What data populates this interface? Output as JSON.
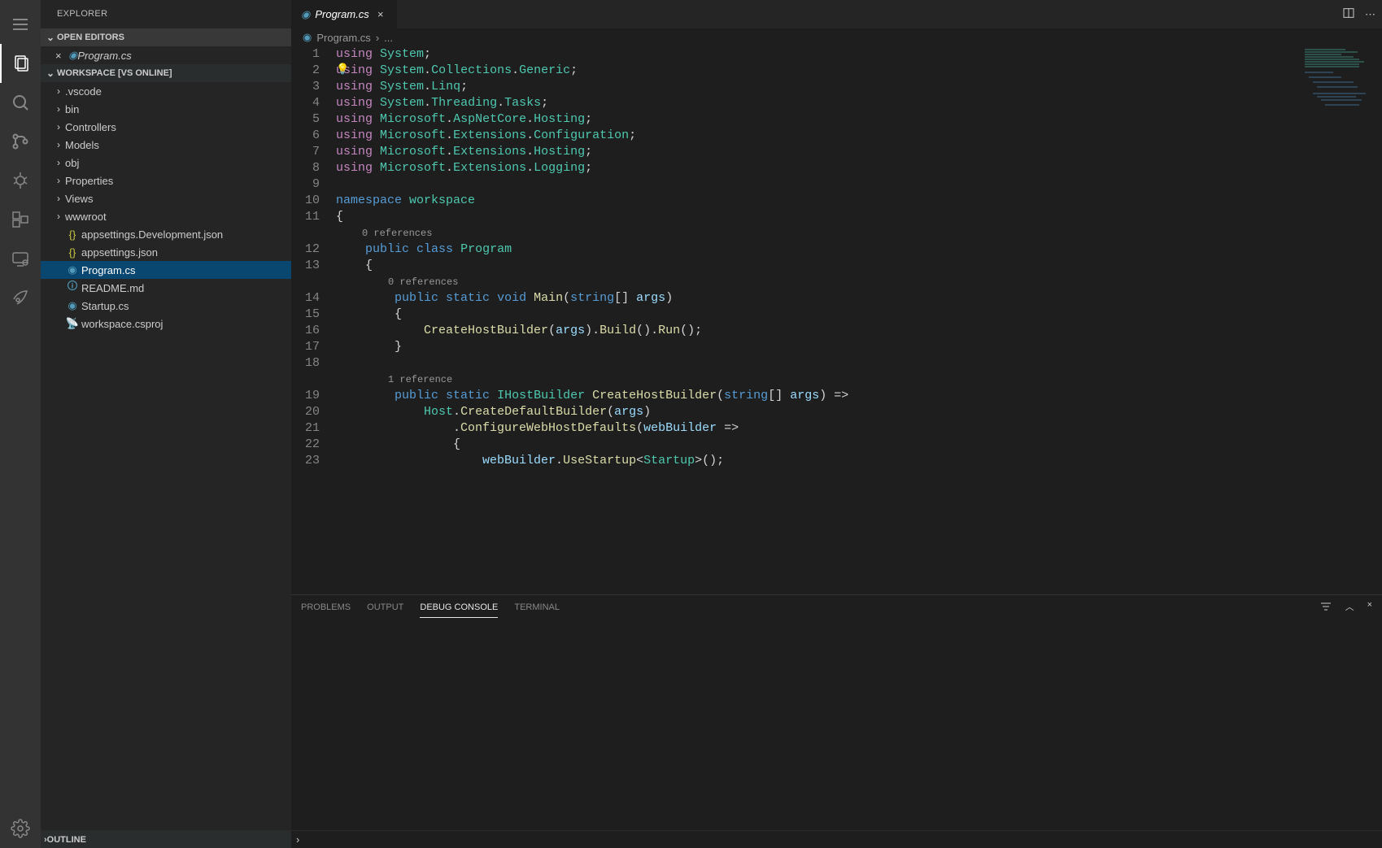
{
  "sidebar": {
    "title": "EXPLORER",
    "openEditorsHeader": "OPEN EDITORS",
    "openEditorItem": "Program.cs",
    "workspaceHeader": "WORKSPACE [VS ONLINE]",
    "outlineHeader": "OUTLINE",
    "folders": [
      ".vscode",
      "bin",
      "Controllers",
      "Models",
      "obj",
      "Properties",
      "Views",
      "wwwroot"
    ],
    "files": [
      {
        "name": "appsettings.Development.json",
        "icon": "json"
      },
      {
        "name": "appsettings.json",
        "icon": "json"
      },
      {
        "name": "Program.cs",
        "icon": "cs",
        "selected": true
      },
      {
        "name": "README.md",
        "icon": "md"
      },
      {
        "name": "Startup.cs",
        "icon": "cs"
      },
      {
        "name": "workspace.csproj",
        "icon": "xml"
      }
    ]
  },
  "tabs": {
    "active": "Program.cs"
  },
  "breadcrumbs": {
    "file": "Program.cs",
    "sep": "›",
    "rest": "..."
  },
  "codelens": {
    "zero": "0 references",
    "one": "1 reference"
  },
  "code": {
    "l1": [
      [
        "kw-using",
        "using"
      ],
      [
        "pl",
        " "
      ],
      [
        "ns",
        "System"
      ],
      [
        "pl",
        ";"
      ]
    ],
    "l2": [
      [
        "kw-using",
        "using"
      ],
      [
        "pl",
        " "
      ],
      [
        "ns",
        "System"
      ],
      [
        "pl",
        "."
      ],
      [
        "ns",
        "Collections"
      ],
      [
        "pl",
        "."
      ],
      [
        "ns",
        "Generic"
      ],
      [
        "pl",
        ";"
      ]
    ],
    "l3": [
      [
        "kw-using",
        "using"
      ],
      [
        "pl",
        " "
      ],
      [
        "ns",
        "System"
      ],
      [
        "pl",
        "."
      ],
      [
        "ns",
        "Linq"
      ],
      [
        "pl",
        ";"
      ]
    ],
    "l4": [
      [
        "kw-using",
        "using"
      ],
      [
        "pl",
        " "
      ],
      [
        "ns",
        "System"
      ],
      [
        "pl",
        "."
      ],
      [
        "ns",
        "Threading"
      ],
      [
        "pl",
        "."
      ],
      [
        "ns",
        "Tasks"
      ],
      [
        "pl",
        ";"
      ]
    ],
    "l5": [
      [
        "kw-using",
        "using"
      ],
      [
        "pl",
        " "
      ],
      [
        "ns",
        "Microsoft"
      ],
      [
        "pl",
        "."
      ],
      [
        "ns",
        "AspNetCore"
      ],
      [
        "pl",
        "."
      ],
      [
        "ns",
        "Hosting"
      ],
      [
        "pl",
        ";"
      ]
    ],
    "l6": [
      [
        "kw-using",
        "using"
      ],
      [
        "pl",
        " "
      ],
      [
        "ns",
        "Microsoft"
      ],
      [
        "pl",
        "."
      ],
      [
        "ns",
        "Extensions"
      ],
      [
        "pl",
        "."
      ],
      [
        "ns",
        "Configuration"
      ],
      [
        "pl",
        ";"
      ]
    ],
    "l7": [
      [
        "kw-using",
        "using"
      ],
      [
        "pl",
        " "
      ],
      [
        "ns",
        "Microsoft"
      ],
      [
        "pl",
        "."
      ],
      [
        "ns",
        "Extensions"
      ],
      [
        "pl",
        "."
      ],
      [
        "ns",
        "Hosting"
      ],
      [
        "pl",
        ";"
      ]
    ],
    "l8": [
      [
        "kw-using",
        "using"
      ],
      [
        "pl",
        " "
      ],
      [
        "ns",
        "Microsoft"
      ],
      [
        "pl",
        "."
      ],
      [
        "ns",
        "Extensions"
      ],
      [
        "pl",
        "."
      ],
      [
        "ns",
        "Logging"
      ],
      [
        "pl",
        ";"
      ]
    ],
    "l10": [
      [
        "kw-blue",
        "namespace"
      ],
      [
        "pl",
        " "
      ],
      [
        "ns",
        "workspace"
      ]
    ],
    "l11": [
      [
        "pl",
        "{"
      ]
    ],
    "l12": [
      [
        "pl",
        "    "
      ],
      [
        "kw-blue",
        "public"
      ],
      [
        "pl",
        " "
      ],
      [
        "kw-blue",
        "class"
      ],
      [
        "pl",
        " "
      ],
      [
        "cls",
        "Program"
      ]
    ],
    "l13": [
      [
        "pl",
        "    {"
      ]
    ],
    "l14": [
      [
        "pl",
        "        "
      ],
      [
        "kw-blue",
        "public"
      ],
      [
        "pl",
        " "
      ],
      [
        "kw-blue",
        "static"
      ],
      [
        "pl",
        " "
      ],
      [
        "kw-blue",
        "void"
      ],
      [
        "pl",
        " "
      ],
      [
        "mth",
        "Main"
      ],
      [
        "pl",
        "("
      ],
      [
        "kw-blue",
        "string"
      ],
      [
        "pl",
        "[] "
      ],
      [
        "var",
        "args"
      ],
      [
        "pl",
        ")"
      ]
    ],
    "l15": [
      [
        "pl",
        "        {"
      ]
    ],
    "l16": [
      [
        "pl",
        "            "
      ],
      [
        "mth",
        "CreateHostBuilder"
      ],
      [
        "pl",
        "("
      ],
      [
        "var",
        "args"
      ],
      [
        "pl",
        ")."
      ],
      [
        "mth",
        "Build"
      ],
      [
        "pl",
        "()."
      ],
      [
        "mth",
        "Run"
      ],
      [
        "pl",
        "();"
      ]
    ],
    "l17": [
      [
        "pl",
        "        }"
      ]
    ],
    "l19": [
      [
        "pl",
        "        "
      ],
      [
        "kw-blue",
        "public"
      ],
      [
        "pl",
        " "
      ],
      [
        "kw-blue",
        "static"
      ],
      [
        "pl",
        " "
      ],
      [
        "cls",
        "IHostBuilder"
      ],
      [
        "pl",
        " "
      ],
      [
        "mth",
        "CreateHostBuilder"
      ],
      [
        "pl",
        "("
      ],
      [
        "kw-blue",
        "string"
      ],
      [
        "pl",
        "[] "
      ],
      [
        "var",
        "args"
      ],
      [
        "pl",
        ") =>"
      ]
    ],
    "l20": [
      [
        "pl",
        "            "
      ],
      [
        "cls",
        "Host"
      ],
      [
        "pl",
        "."
      ],
      [
        "mth",
        "CreateDefaultBuilder"
      ],
      [
        "pl",
        "("
      ],
      [
        "var",
        "args"
      ],
      [
        "pl",
        ")"
      ]
    ],
    "l21": [
      [
        "pl",
        "                ."
      ],
      [
        "mth",
        "ConfigureWebHostDefaults"
      ],
      [
        "pl",
        "("
      ],
      [
        "var",
        "webBuilder"
      ],
      [
        "pl",
        " =>"
      ]
    ],
    "l22": [
      [
        "pl",
        "                {"
      ]
    ],
    "l23": [
      [
        "pl",
        "                    "
      ],
      [
        "var",
        "webBuilder"
      ],
      [
        "pl",
        "."
      ],
      [
        "mth",
        "UseStartup"
      ],
      [
        "pl",
        "<"
      ],
      [
        "cls",
        "Startup"
      ],
      [
        "pl",
        ">();"
      ]
    ]
  },
  "lineNumbers": [
    "1",
    "2",
    "3",
    "4",
    "5",
    "6",
    "7",
    "8",
    "9",
    "10",
    "11",
    "",
    "12",
    "13",
    "",
    "14",
    "15",
    "16",
    "17",
    "18",
    "",
    "19",
    "20",
    "21",
    "22",
    "23"
  ],
  "panel": {
    "tabs": [
      "PROBLEMS",
      "OUTPUT",
      "DEBUG CONSOLE",
      "TERMINAL"
    ],
    "active": 2
  }
}
